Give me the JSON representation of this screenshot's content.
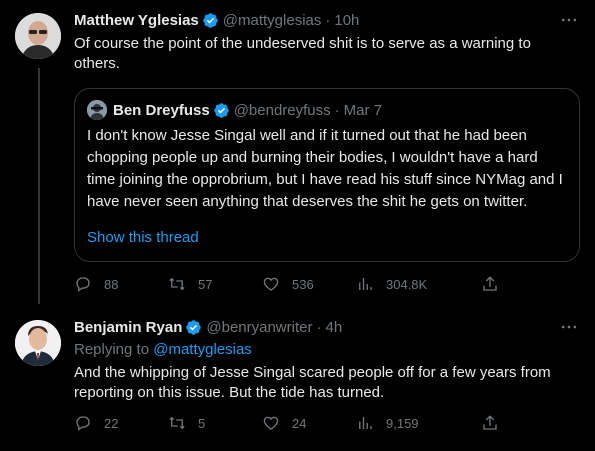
{
  "tweet1": {
    "name": "Matthew Yglesias",
    "handle": "@mattyglesias",
    "separator": "·",
    "time": "10h",
    "text": "Of course the point of the undeserved shit is to serve as a warning to others.",
    "quote": {
      "name": "Ben Dreyfuss",
      "handle": "@bendreyfuss",
      "separator": "·",
      "time": "Mar 7",
      "text": "I don't know Jesse Singal well and if it turned out that he had been chopping people up and burning their bodies, I wouldn't have a hard time joining the opprobrium, but I have read his stuff since NYMag and I have never seen anything that deserves the shit he gets on twitter.",
      "show_thread": "Show this thread"
    },
    "stats": {
      "replies": "88",
      "retweets": "57",
      "likes": "536",
      "views": "304.8K"
    }
  },
  "tweet2": {
    "name": "Benjamin Ryan",
    "handle": "@benryanwriter",
    "separator": "·",
    "time": "4h",
    "replying_prefix": "Replying to",
    "replying_to": "@mattyglesias",
    "text": "And the whipping of Jesse Singal scared people off for a few years from reporting on this issue. But the tide has turned.",
    "stats": {
      "replies": "22",
      "retweets": "5",
      "likes": "24",
      "views": "9,159"
    }
  },
  "colors": {
    "background": "#000000",
    "text": "#e7e9ea",
    "muted": "#71767b",
    "accent": "#1d9bf0",
    "border": "#2f3336"
  },
  "icons": [
    "verified-icon",
    "more-icon",
    "reply-icon",
    "retweet-icon",
    "like-icon",
    "views-icon",
    "share-icon"
  ]
}
